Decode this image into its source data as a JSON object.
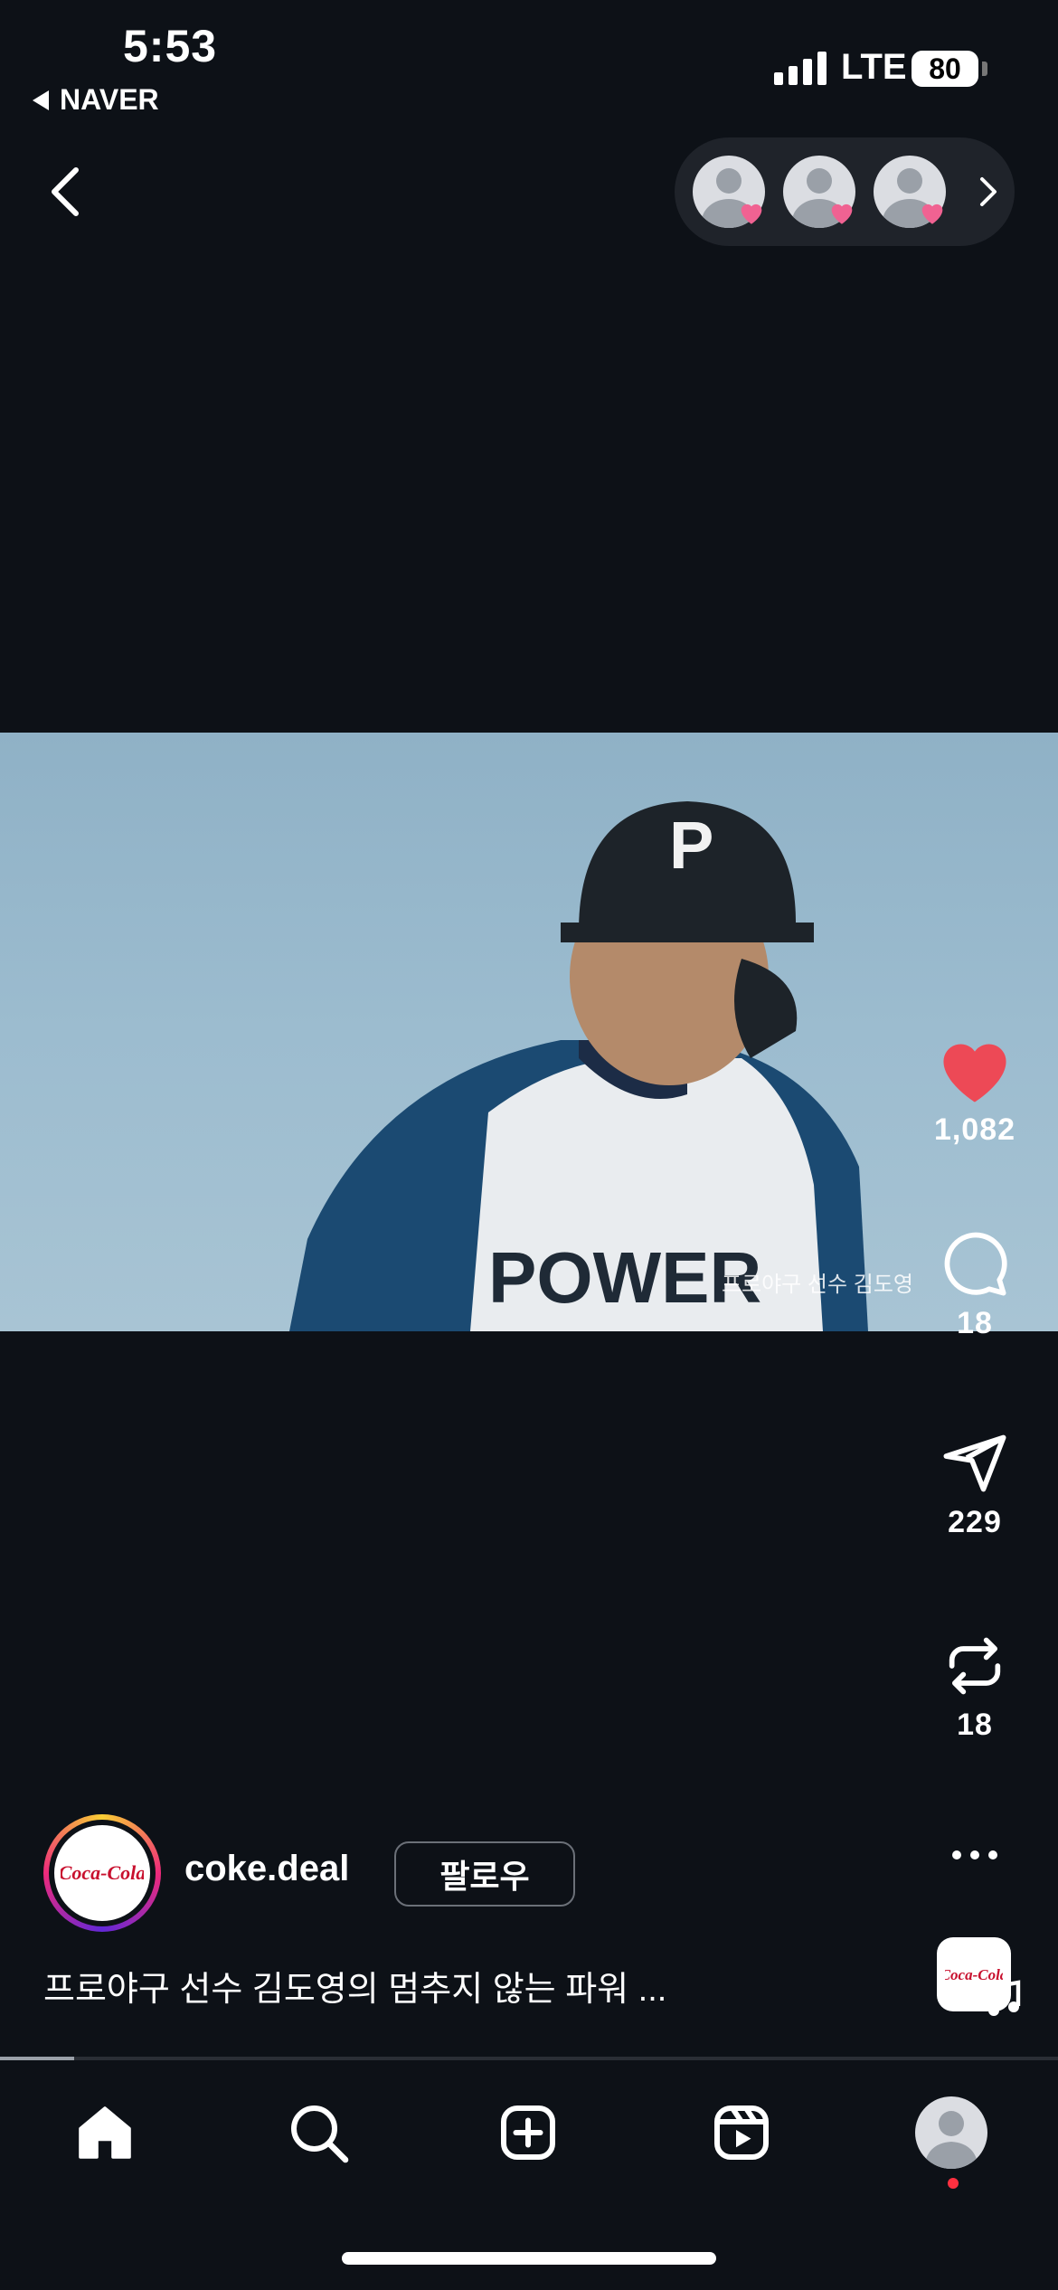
{
  "status_bar": {
    "time": "5:53",
    "back_app": "NAVER",
    "network": "LTE",
    "battery": "80"
  },
  "video": {
    "watermark": "프로야구 선수 김도영",
    "progress_percent": 7
  },
  "actions": {
    "likes": "1,082",
    "comments": "18",
    "shares": "229",
    "reposts": "18"
  },
  "author": {
    "username": "coke.deal",
    "logo_text": "Coca-Cola",
    "follow_label": "팔로우"
  },
  "caption": "프로야구 선수 김도영의 멈추지 않는 파워 ...",
  "colors": {
    "background": "#0d1117",
    "like_red": "#ed4956",
    "coke_red": "#c8102e"
  },
  "icons": {
    "nav": [
      "chevron-left-icon",
      "chevron-right-icon"
    ],
    "actions": [
      "heart-icon",
      "comment-icon",
      "send-icon",
      "repost-icon",
      "more-icon",
      "music-note-icon"
    ],
    "tabs": [
      "home-icon",
      "search-icon",
      "create-icon",
      "reels-icon",
      "profile-icon"
    ]
  }
}
